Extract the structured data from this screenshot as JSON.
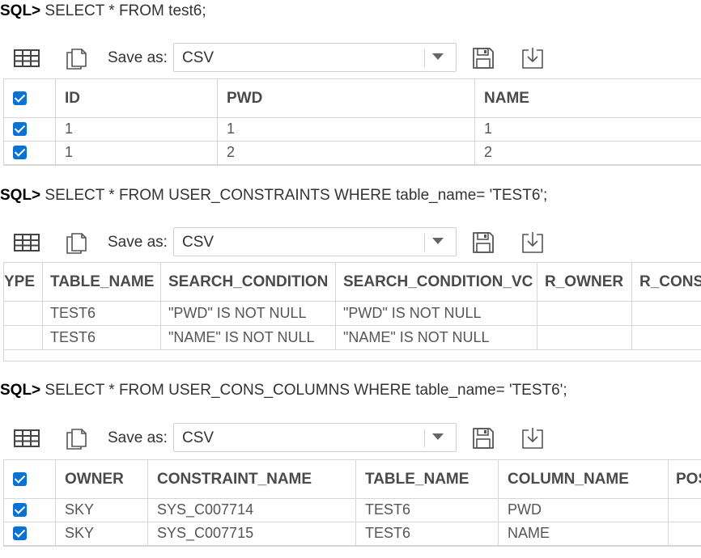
{
  "toolbar": {
    "save_as_label": "Save as:",
    "format_value": "CSV"
  },
  "queries": [
    {
      "prompt": "SQL>",
      "statement": " SELECT * FROM test6;",
      "columns": [
        "",
        "ID",
        "PWD",
        "NAME"
      ],
      "rows": [
        [
          "",
          "1",
          "1",
          "1"
        ],
        [
          "",
          "1",
          "2",
          "2"
        ]
      ]
    },
    {
      "prompt": "SQL>",
      "statement": " SELECT * FROM USER_CONSTRAINTS WHERE table_name= 'TEST6';",
      "columns": [
        "YPE",
        "TABLE_NAME",
        "SEARCH_CONDITION",
        "SEARCH_CONDITION_VC",
        "R_OWNER",
        "R_CONST"
      ],
      "rows": [
        [
          "",
          "TEST6",
          "\"PWD\" IS NOT NULL",
          "\"PWD\" IS NOT NULL",
          "",
          ""
        ],
        [
          "",
          "TEST6",
          "\"NAME\" IS NOT NULL",
          "\"NAME\" IS NOT NULL",
          "",
          ""
        ]
      ]
    },
    {
      "prompt": "SQL>",
      "statement": " SELECT * FROM USER_CONS_COLUMNS WHERE table_name= 'TEST6';",
      "columns": [
        "",
        "OWNER",
        "CONSTRAINT_NAME",
        "TABLE_NAME",
        "COLUMN_NAME",
        "POS"
      ],
      "rows": [
        [
          "",
          "SKY",
          "SYS_C007714",
          "TEST6",
          "PWD",
          ""
        ],
        [
          "",
          "SKY",
          "SYS_C007715",
          "TEST6",
          "NAME",
          ""
        ]
      ]
    }
  ],
  "icons": {
    "grid": "table-grid-icon",
    "copy": "copy-icon",
    "save": "floppy-save-icon",
    "download": "download-icon",
    "dropdown": "chevron-down-icon",
    "checkbox": "checkbox-checked-icon"
  },
  "colors": {
    "checkbox": "#0b72d3",
    "border": "#d6d6d6"
  }
}
